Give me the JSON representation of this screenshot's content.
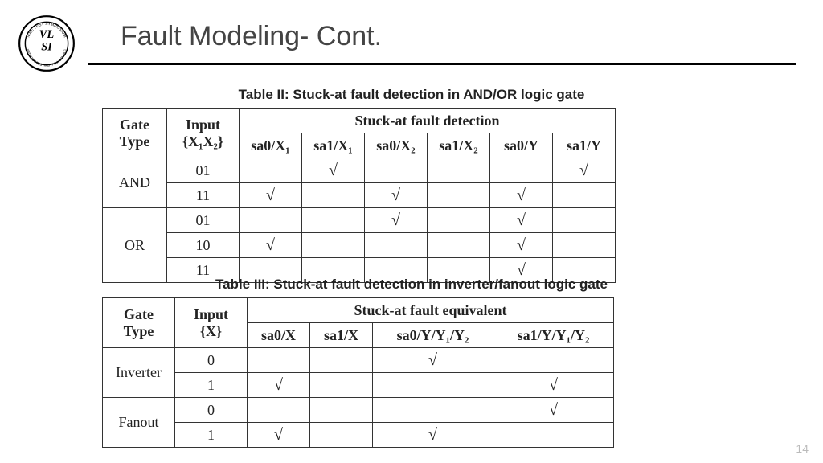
{
  "page_number": "14",
  "title": "Fault Modeling- Cont.",
  "check_symbol": "√",
  "table2": {
    "caption": "Table II: Stuck-at fault detection in AND/OR logic gate",
    "head": {
      "gate_type": "Gate Type",
      "input": "Input",
      "input_sub": "{X₁X₂}",
      "group": "Stuck-at fault detection",
      "cols": [
        "sa0/X₁",
        "sa1/X₁",
        "sa0/X₂",
        "sa1/X₂",
        "sa0/Y",
        "sa1/Y"
      ]
    },
    "groups": [
      {
        "gate": "AND",
        "rows": [
          {
            "input": "01",
            "marks": [
              false,
              true,
              false,
              false,
              false,
              true
            ]
          },
          {
            "input": "11",
            "marks": [
              true,
              false,
              true,
              false,
              true,
              false
            ]
          }
        ]
      },
      {
        "gate": "OR",
        "rows": [
          {
            "input": "01",
            "marks": [
              false,
              false,
              true,
              false,
              true,
              false
            ]
          },
          {
            "input": "10",
            "marks": [
              true,
              false,
              false,
              false,
              true,
              false
            ]
          },
          {
            "input": "11",
            "marks": [
              false,
              false,
              false,
              false,
              true,
              false
            ]
          }
        ]
      }
    ]
  },
  "table3": {
    "caption": "Table III: Stuck-at fault detection in inverter/fanout logic gate",
    "head": {
      "gate_type": "Gate Type",
      "input": "Input",
      "input_sub": "{X}",
      "group": "Stuck-at fault equivalent",
      "cols": [
        "sa0/X",
        "sa1/X",
        "sa0/Y/Y₁/Y₂",
        "sa1/Y/Y₁/Y₂"
      ]
    },
    "groups": [
      {
        "gate": "Inverter",
        "rows": [
          {
            "input": "0",
            "marks": [
              false,
              false,
              true,
              false
            ]
          },
          {
            "input": "1",
            "marks": [
              true,
              false,
              false,
              true
            ]
          }
        ]
      },
      {
        "gate": "Fanout",
        "rows": [
          {
            "input": "0",
            "marks": [
              false,
              false,
              false,
              true
            ]
          },
          {
            "input": "1",
            "marks": [
              true,
              false,
              true,
              false
            ]
          }
        ]
      }
    ]
  }
}
